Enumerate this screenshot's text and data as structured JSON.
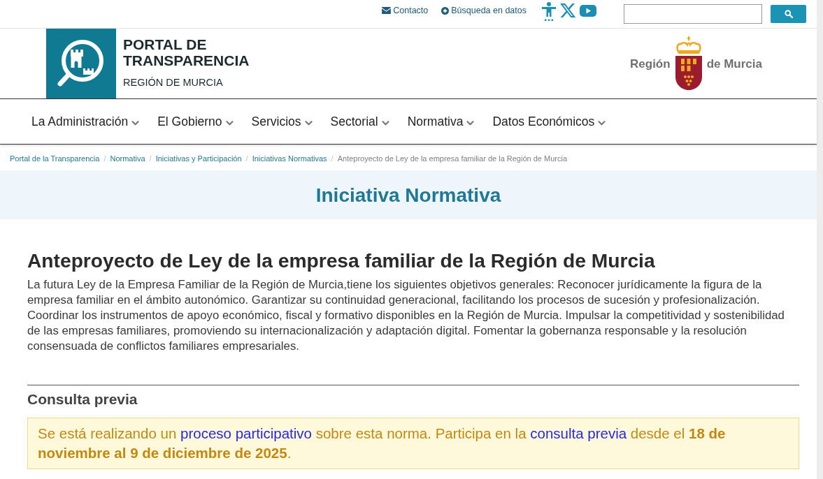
{
  "top_bar": {
    "links": [
      {
        "label": "Contacto"
      },
      {
        "label": "Búsqueda en datos"
      }
    ]
  },
  "header": {
    "portal_logo": {
      "title_lines": [
        "PORTAL DE",
        "TRANSPARENCIA"
      ],
      "subtitle": "REGIÓN DE MURCIA"
    },
    "region_logo": {
      "left_text": "Región",
      "right_text": "de Murcia"
    }
  },
  "nav": {
    "items": [
      {
        "label": "La Administración"
      },
      {
        "label": "El Gobierno"
      },
      {
        "label": "Servicios"
      },
      {
        "label": "Sectorial"
      },
      {
        "label": "Normativa"
      },
      {
        "label": "Datos Económicos"
      }
    ]
  },
  "breadcrumb": [
    {
      "label": "Portal de la Transparencia",
      "current": false
    },
    {
      "separator": "/",
      "label": "Normativa",
      "current": false
    },
    {
      "separator": "/",
      "label": "Iniciativas y Participación",
      "current": false
    },
    {
      "separator": "/",
      "label": "Iniciativas Normativas",
      "current": false
    },
    {
      "separator": "/",
      "label": "Anteproyecto de Ley de la empresa familiar de la Región de Murcia",
      "current": true
    }
  ],
  "banner": {
    "title": "Iniciativa Normativa"
  },
  "article": {
    "title": "Anteproyecto de Ley de la empresa familiar de la Región de Murcia",
    "description": "La futura Ley de la Empresa Familiar de la Región de Murcia,tiene los siguientes objetivos generales: Reconocer jurídicamente la figura de la empresa familiar en el ámbito autonómico. Garantizar su continuidad generacional, facilitando los procesos de sucesión y profesionalización. Coordinar los instrumentos de apoyo económico, fiscal y formativo disponibles en la Región de Murcia. Impulsar la competitividad y sostenibilidad de las empresas familiares, promoviendo su internacionalización y adaptación digital. Fomentar la gobernanza responsable y la resolución consensuada de conflictos familiares empresariales."
  },
  "consultation": {
    "heading": "Consulta previa",
    "notice": [
      {
        "kind": "text",
        "text": "Se está realizando un "
      },
      {
        "kind": "link",
        "text": "proceso participativo"
      },
      {
        "kind": "text",
        "text": " sobre esta norma. Participa en la "
      },
      {
        "kind": "link",
        "text": "consulta previa"
      },
      {
        "kind": "text",
        "text": " desde el "
      },
      {
        "kind": "bold",
        "text": "18 de noviembre al 9 de diciembre de 2025"
      },
      {
        "kind": "text",
        "text": "."
      }
    ]
  }
}
